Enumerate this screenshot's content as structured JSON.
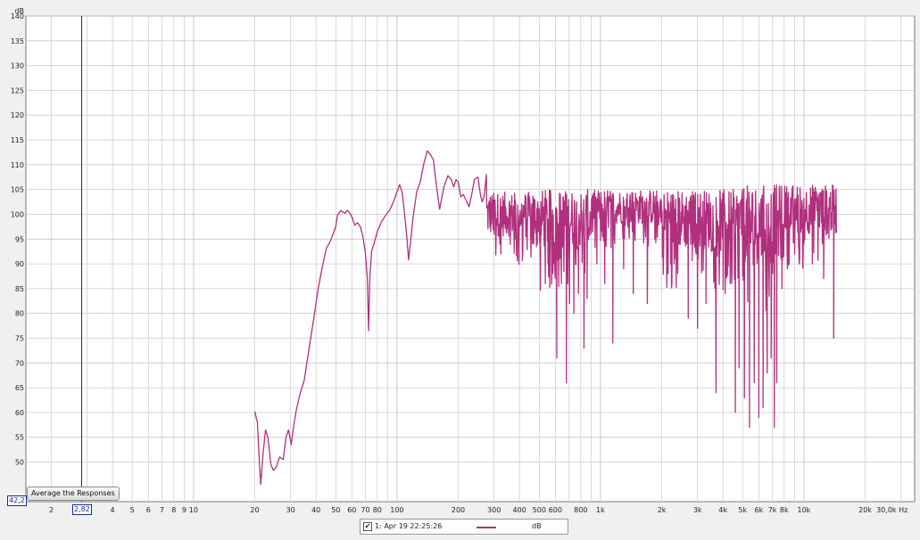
{
  "chart_data": {
    "type": "line",
    "title": "",
    "xlabel": "Hz",
    "ylabel": "dB",
    "x_scale": "log",
    "xlim": [
      1.5,
      35000
    ],
    "ylim": [
      42,
      140
    ],
    "grid": true,
    "x_ticks": [
      {
        "value": 2,
        "label": "2"
      },
      {
        "value": 4,
        "label": "4"
      },
      {
        "value": 5,
        "label": "5"
      },
      {
        "value": 6,
        "label": "6"
      },
      {
        "value": 7,
        "label": "7"
      },
      {
        "value": 8,
        "label": "8"
      },
      {
        "value": 9,
        "label": "9"
      },
      {
        "value": 10,
        "label": "10"
      },
      {
        "value": 20,
        "label": "20"
      },
      {
        "value": 30,
        "label": "30"
      },
      {
        "value": 40,
        "label": "40"
      },
      {
        "value": 50,
        "label": "50"
      },
      {
        "value": 60,
        "label": "60"
      },
      {
        "value": 70,
        "label": "70"
      },
      {
        "value": 80,
        "label": "80"
      },
      {
        "value": 100,
        "label": "100"
      },
      {
        "value": 200,
        "label": "200"
      },
      {
        "value": 300,
        "label": "300"
      },
      {
        "value": 400,
        "label": "400"
      },
      {
        "value": 500,
        "label": "500"
      },
      {
        "value": 600,
        "label": "600"
      },
      {
        "value": 800,
        "label": "800"
      },
      {
        "value": 1000,
        "label": "1k"
      },
      {
        "value": 2000,
        "label": "2k"
      },
      {
        "value": 3000,
        "label": "3k"
      },
      {
        "value": 4000,
        "label": "4k"
      },
      {
        "value": 5000,
        "label": "5k"
      },
      {
        "value": 6000,
        "label": "6k"
      },
      {
        "value": 7000,
        "label": "7k"
      },
      {
        "value": 8000,
        "label": "8k"
      },
      {
        "value": 10000,
        "label": "10k"
      },
      {
        "value": 20000,
        "label": "20k"
      },
      {
        "value": 30000,
        "label": "30,0k Hz"
      }
    ],
    "y_ticks": [
      50,
      55,
      60,
      65,
      70,
      75,
      80,
      85,
      90,
      95,
      100,
      105,
      110,
      115,
      120,
      125,
      130,
      135,
      140
    ],
    "series": [
      {
        "name": "1: Apr 19 22:25:26",
        "color": "#b0307e",
        "points": [
          [
            20,
            60.2
          ],
          [
            20.6,
            58
          ],
          [
            21,
            51
          ],
          [
            21.4,
            45.5
          ],
          [
            22,
            52
          ],
          [
            22.6,
            56.5
          ],
          [
            23.2,
            55
          ],
          [
            24,
            49.5
          ],
          [
            24.7,
            48.3
          ],
          [
            25.5,
            49
          ],
          [
            26.5,
            51
          ],
          [
            27.6,
            50.5
          ],
          [
            28.5,
            55
          ],
          [
            29.3,
            56.5
          ],
          [
            30.2,
            53.5
          ],
          [
            31,
            57
          ],
          [
            32,
            60.5
          ],
          [
            33.5,
            64
          ],
          [
            35,
            66.5
          ],
          [
            37,
            73
          ],
          [
            39,
            79
          ],
          [
            41,
            85
          ],
          [
            43,
            89.5
          ],
          [
            45,
            93.2
          ],
          [
            47,
            94.5
          ],
          [
            49,
            96.5
          ],
          [
            50,
            97.5
          ],
          [
            51,
            99.8
          ],
          [
            52,
            100.3
          ],
          [
            53,
            100.8
          ],
          [
            54,
            100.5
          ],
          [
            55.5,
            100.2
          ],
          [
            57,
            100.8
          ],
          [
            58,
            100.5
          ],
          [
            60,
            99.5
          ],
          [
            62,
            97.8
          ],
          [
            64,
            98.3
          ],
          [
            66,
            97.5
          ],
          [
            68,
            95.5
          ],
          [
            70,
            92
          ],
          [
            71.5,
            87
          ],
          [
            72.5,
            76.5
          ],
          [
            73.5,
            87
          ],
          [
            75,
            92.5
          ],
          [
            77,
            94
          ],
          [
            80,
            96.5
          ],
          [
            84,
            98.5
          ],
          [
            88,
            99.8
          ],
          [
            92,
            100.8
          ],
          [
            96,
            102.5
          ],
          [
            100,
            104.5
          ],
          [
            103,
            106
          ],
          [
            106,
            104.5
          ],
          [
            109,
            100
          ],
          [
            112,
            95
          ],
          [
            114,
            90.8
          ],
          [
            117,
            95
          ],
          [
            120,
            99.5
          ],
          [
            125,
            104.5
          ],
          [
            130,
            106.5
          ],
          [
            136,
            110.5
          ],
          [
            141,
            112.8
          ],
          [
            146,
            112
          ],
          [
            151,
            111
          ],
          [
            156,
            106
          ],
          [
            162,
            101
          ],
          [
            170,
            105.5
          ],
          [
            178,
            107.8
          ],
          [
            185,
            107
          ],
          [
            190,
            105.5
          ],
          [
            195,
            107
          ],
          [
            200,
            106.5
          ],
          [
            206,
            103.5
          ],
          [
            212,
            104
          ],
          [
            220,
            102.5
          ],
          [
            226,
            101.5
          ],
          [
            233,
            104
          ],
          [
            240,
            107
          ],
          [
            250,
            107.5
          ],
          [
            257,
            104
          ],
          [
            262,
            102.5
          ],
          [
            268,
            103.5
          ],
          [
            275,
            108
          ]
        ],
        "noisy_segments": [
          {
            "from": 275,
            "to": 500,
            "base": 100,
            "amp": 4.5,
            "dips": [
              [
                300,
                96
              ],
              [
                320,
                94
              ],
              [
                352,
                97
              ],
              [
                380,
                95
              ],
              [
                430,
                95.5
              ],
              [
                470,
                94
              ]
            ]
          },
          {
            "from": 500,
            "to": 900,
            "base": 99,
            "amp": 6,
            "dips": [
              [
                536,
                86
              ],
              [
                552,
                90
              ],
              [
                588,
                90
              ],
              [
                610,
                71
              ],
              [
                643,
                86
              ],
              [
                680,
                66
              ],
              [
                705,
                82
              ],
              [
                740,
                80
              ],
              [
                780,
                84
              ],
              [
                830,
                73
              ],
              [
                860,
                83
              ]
            ]
          },
          {
            "from": 900,
            "to": 2000,
            "base": 101.5,
            "amp": 3.5,
            "dips": [
              [
                960,
                90
              ],
              [
                1050,
                86
              ],
              [
                1150,
                74
              ],
              [
                1300,
                89
              ],
              [
                1450,
                84
              ],
              [
                1700,
                82
              ],
              [
                1850,
                95
              ]
            ]
          },
          {
            "from": 2000,
            "to": 5000,
            "base": 99,
            "amp": 6,
            "dips": [
              [
                2150,
                88
              ],
              [
                2300,
                90
              ],
              [
                2700,
                79
              ],
              [
                3000,
                77
              ],
              [
                3300,
                82
              ],
              [
                3700,
                64
              ],
              [
                4100,
                84
              ],
              [
                4600,
                60
              ],
              [
                4800,
                69
              ],
              [
                5100,
                63
              ]
            ]
          },
          {
            "from": 5000,
            "to": 7500,
            "base": 98,
            "amp": 8,
            "dips": [
              [
                5400,
                57
              ],
              [
                5700,
                66
              ],
              [
                6000,
                59
              ],
              [
                6300,
                61
              ],
              [
                6600,
                68
              ],
              [
                6900,
                71
              ],
              [
                7150,
                57
              ],
              [
                7350,
                66
              ]
            ]
          },
          {
            "from": 7500,
            "to": 14500,
            "base": 101,
            "amp": 5,
            "dips": [
              [
                7800,
                85
              ],
              [
                8300,
                89
              ],
              [
                9000,
                92
              ],
              [
                10000,
                94
              ],
              [
                11000,
                90
              ],
              [
                12500,
                87
              ],
              [
                14000,
                75
              ]
            ]
          }
        ]
      }
    ],
    "cursor": {
      "x": 2.82,
      "x_label": "2,82",
      "y_label": "42,2"
    }
  },
  "controls": {
    "average_button_label": "Average the Responses"
  },
  "legend": {
    "checkbox_mark": "✔",
    "label": "1: Apr 19 22:25:26",
    "unit": "dB",
    "color": "#b0307e"
  },
  "colors": {
    "plot_bg": "#ffffff",
    "grid": "#c9c9c9",
    "cursor": "#1a2a9a"
  }
}
